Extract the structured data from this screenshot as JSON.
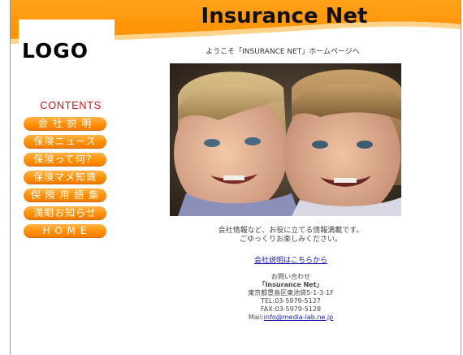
{
  "header": {
    "logo_text": "LOGO",
    "site_title": "Insurance Net",
    "welcome": "ようこそ「INSURANCE NET」ホームページへ"
  },
  "sidebar": {
    "heading": "CONTENTS",
    "items": [
      {
        "label": "会 社 説 明"
      },
      {
        "label": "保険ニュース"
      },
      {
        "label": "保険って何？"
      },
      {
        "label": "保険マメ知識"
      },
      {
        "label": "保 険 用 語 集"
      },
      {
        "label": "満期お知らせ"
      },
      {
        "label": "H O M E"
      }
    ]
  },
  "main": {
    "info_line1": "会社情報など、お役に立てる情報満載です。",
    "info_line2": "ごゆっくりお楽しみください。",
    "company_link": "会社説明はこちらから"
  },
  "contact": {
    "heading": "お問い合わせ",
    "company": "「Insurance Net」",
    "address": "東京都豊島区東池袋5-1-3-1F",
    "tel": "TEL:03-5979-5127",
    "fax": "FAX:03-5979-5128",
    "mail_label": "Mail:",
    "mail": "info@media-lab.ne.jp"
  },
  "colors": {
    "accent_orange": "#ff9400",
    "heading_red": "#cc1a1a",
    "link_blue": "#1a1aa8"
  },
  "icons": {
    "hero": "children-photo"
  }
}
